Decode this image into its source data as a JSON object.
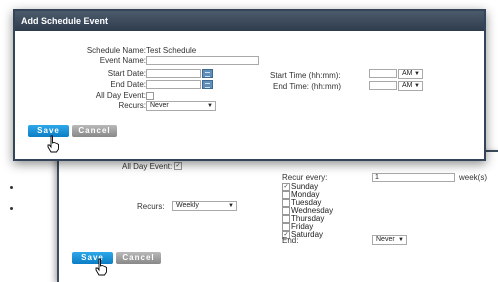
{
  "front": {
    "title": "Add Schedule Event",
    "schedule_name_label": "Schedule Name:",
    "schedule_name_value": "Test Schedule",
    "event_name_label": "Event Name:",
    "start_date_label": "Start Date:",
    "end_date_label": "End Date:",
    "all_day_label": "All Day Event:",
    "recurs_label": "Recurs:",
    "recurs_value": "Never",
    "start_time_label": "Start Time (hh:mm):",
    "end_time_label": "End Time: (hh:mm)",
    "start_ampm": "AM",
    "end_ampm": "AM",
    "save": "Save",
    "cancel": "Cancel"
  },
  "back": {
    "all_day_label": "All Day Event:",
    "recurs_label": "Recurs:",
    "recurs_value": "Weekly",
    "recur_every_label": "Recur every:",
    "recur_every_value": "1",
    "recur_unit": "week(s)",
    "days": [
      {
        "label": "Sunday",
        "checked": true
      },
      {
        "label": "Monday",
        "checked": false
      },
      {
        "label": "Tuesday",
        "checked": false
      },
      {
        "label": "Wednesday",
        "checked": false
      },
      {
        "label": "Thursday",
        "checked": false
      },
      {
        "label": "Friday",
        "checked": false
      },
      {
        "label": "Saturday",
        "checked": true
      }
    ],
    "end_label": "End:",
    "end_value": "Never",
    "save": "Save",
    "cancel": "Cancel"
  },
  "icons": {
    "calendar": "calendar-icon",
    "cursor": "hand-cursor-icon",
    "dropdown": "chevron-down-icon"
  }
}
